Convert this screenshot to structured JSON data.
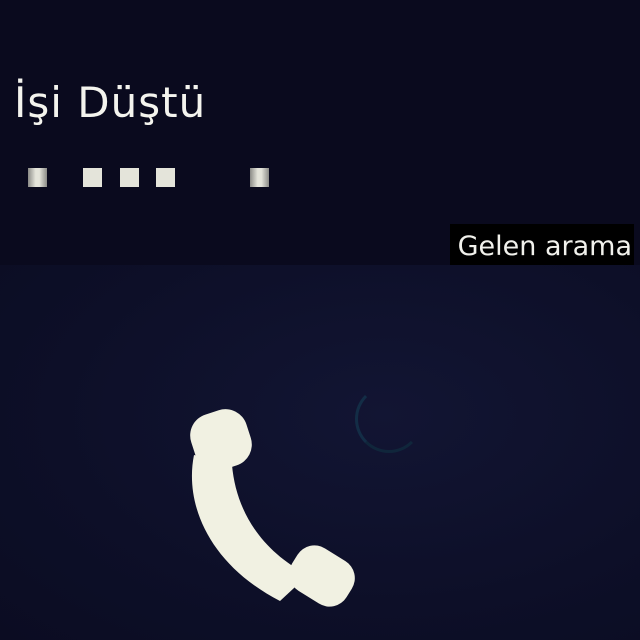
{
  "caller": {
    "name": "İşi Düştü"
  },
  "number_mask": {
    "squares_visible": 5
  },
  "call_status": {
    "label": "Gelen arama"
  },
  "answer": {
    "icon": "phone-handset-icon",
    "icon_color": "#f1f1e2"
  },
  "colors": {
    "background": "#0b0c22",
    "text": "#f4f4ee"
  }
}
